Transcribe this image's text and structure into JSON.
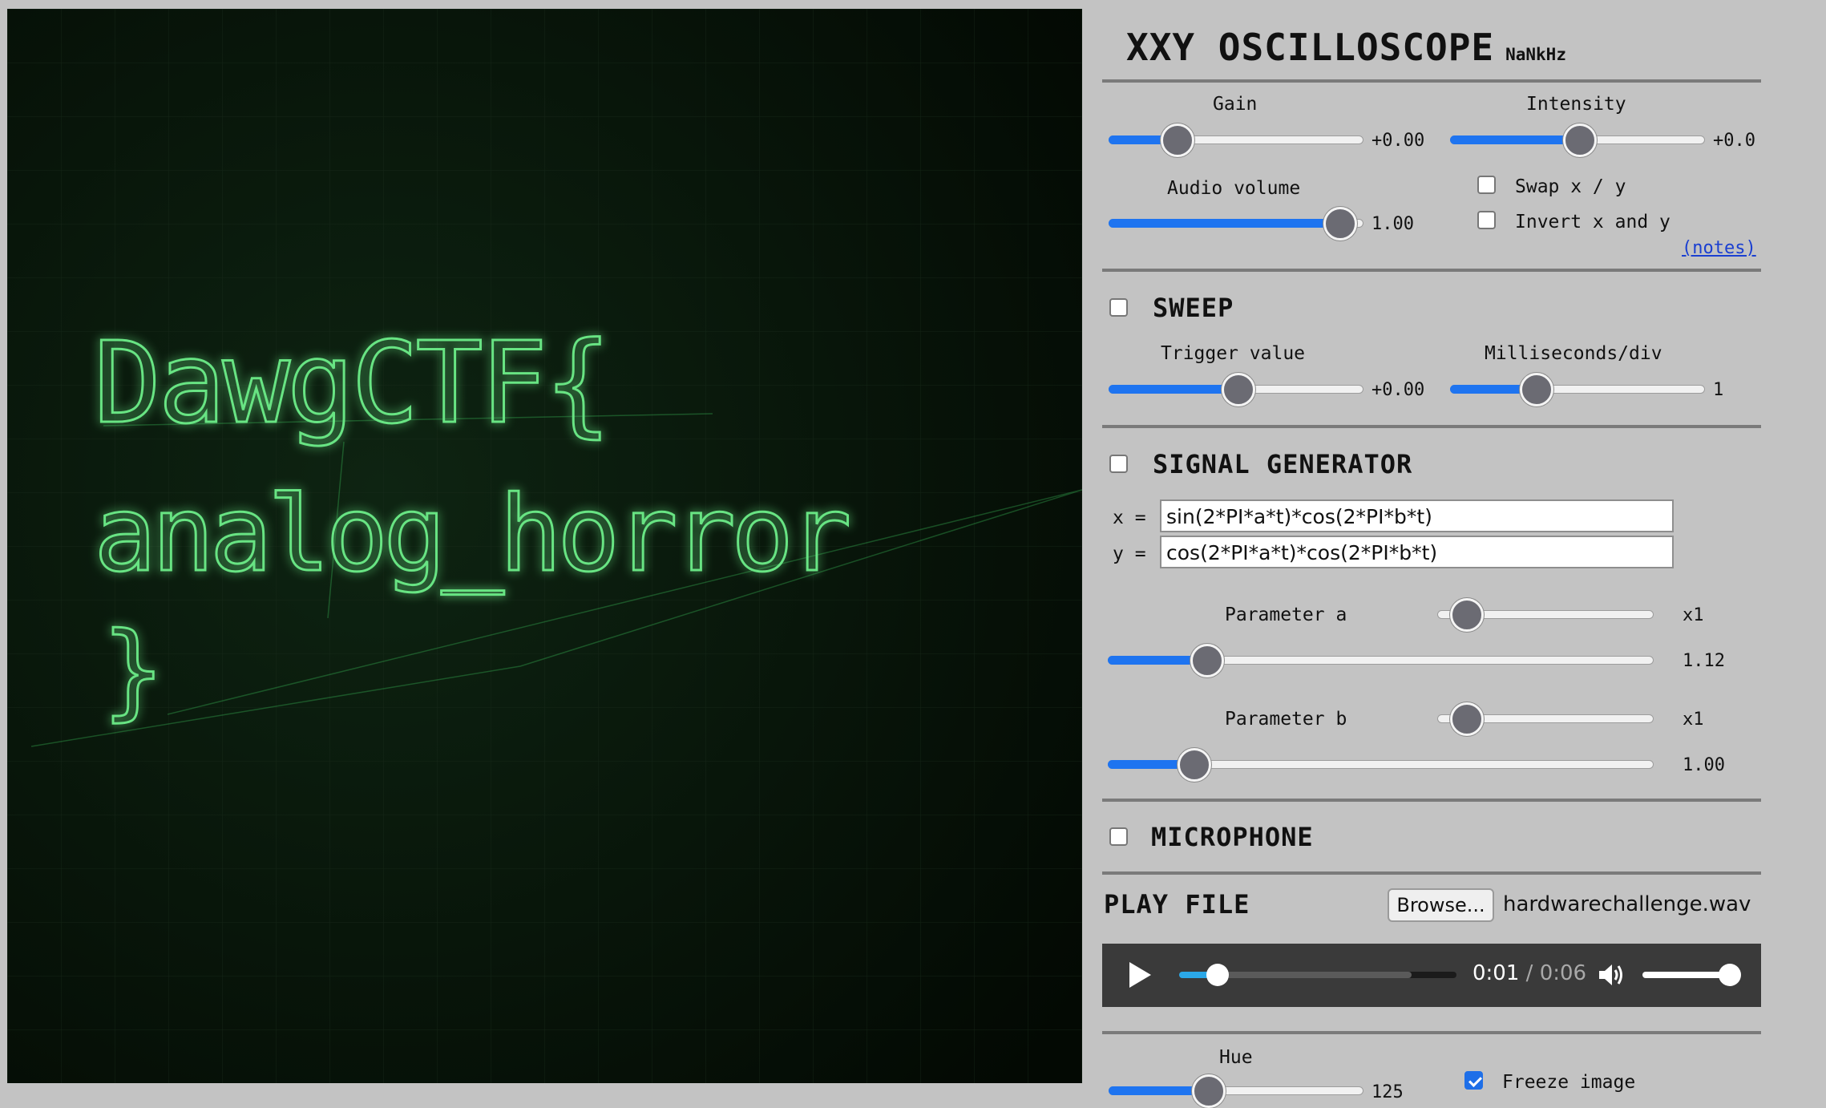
{
  "screen": {
    "glow_color": "#4cd66b",
    "line1": "DawgCTF{",
    "line2": "analog_horror",
    "line3": "}"
  },
  "header": {
    "title": "XXY OSCILLOSCOPE",
    "frequency": "NaNkHz"
  },
  "controls": {
    "gain": {
      "label": "Gain",
      "value": "+0.00",
      "level": 0.23
    },
    "intensity": {
      "label": "Intensity",
      "value": "+0.0",
      "level": 0.5
    },
    "audio_volume": {
      "label": "Audio volume",
      "value": "1.00",
      "level": 0.95
    },
    "swap_label": "Swap x / y",
    "swap_checked": false,
    "invert_label": "Invert x and y",
    "invert_checked": false,
    "notes_link": "(notes)"
  },
  "sweep": {
    "title": "SWEEP",
    "enabled": false,
    "trigger": {
      "label": "Trigger value",
      "value": "+0.00",
      "level": 0.5
    },
    "ms_div": {
      "label": "Milliseconds/div",
      "value": "1",
      "level": 0.31
    }
  },
  "signal_generator": {
    "title": "SIGNAL GENERATOR",
    "enabled": false,
    "x_label": "x =",
    "x_expr": "sin(2*PI*a*t)*cos(2*PI*b*t)",
    "y_label": "y =",
    "y_expr": "cos(2*PI*a*t)*cos(2*PI*b*t)",
    "param_a": {
      "label": "Parameter a",
      "multiplier": "x1",
      "multiplier_level": 0.07,
      "value": "1.12",
      "level": 0.16
    },
    "param_b": {
      "label": "Parameter b",
      "multiplier": "x1",
      "multiplier_level": 0.07,
      "value": "1.00",
      "level": 0.135
    }
  },
  "microphone": {
    "title": "MICROPHONE",
    "enabled": false
  },
  "play_file": {
    "title": "PLAY FILE",
    "browse_label": "Browse...",
    "file_name": "hardwarechallenge.wav",
    "current_time": "0:01",
    "separator": "/",
    "duration": "0:06",
    "progress": 0.14,
    "volume": 0.88
  },
  "display": {
    "hue": {
      "label": "Hue",
      "value": "125",
      "level": 0.37
    },
    "freeze_label": "Freeze image",
    "freeze_checked": true
  },
  "colors": {
    "accent": "#1e74f0",
    "screen_bg": "#061006",
    "panel_bg": "#c3c3c3"
  }
}
